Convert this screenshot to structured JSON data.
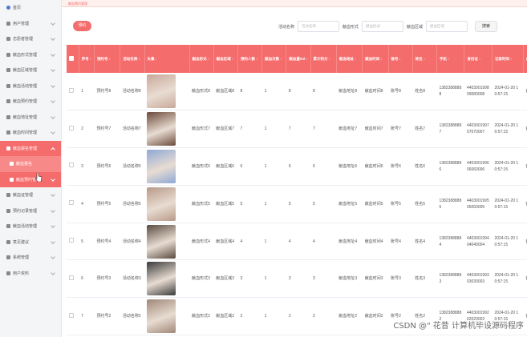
{
  "sidebar": {
    "items": [
      {
        "label": "首页",
        "icon": "home-icon"
      },
      {
        "label": "用户管理",
        "icon": "grid-icon"
      },
      {
        "label": "志愿者管理",
        "icon": "grid-icon"
      },
      {
        "label": "献血形式管理",
        "icon": "grid-icon"
      },
      {
        "label": "献血区域管理",
        "icon": "grid-icon"
      },
      {
        "label": "献血活动管理",
        "icon": "pin-icon"
      },
      {
        "label": "献血预约管理",
        "icon": "flag-icon"
      },
      {
        "label": "献血地址管理",
        "icon": "grid-icon"
      },
      {
        "label": "献血时间管理",
        "icon": "grid-icon"
      },
      {
        "label": "献血报名管理",
        "icon": "grid-icon"
      },
      {
        "label": "献血报名",
        "icon": "dot-icon"
      },
      {
        "label": "献血预约管理",
        "icon": "dot-icon"
      },
      {
        "label": "献血证管理",
        "icon": "card-icon"
      },
      {
        "label": "预约记录管理",
        "icon": "grid-icon"
      },
      {
        "label": "献血活动管理",
        "icon": "grid-icon"
      },
      {
        "label": "意见建议",
        "icon": "grid-icon"
      },
      {
        "label": "系统管理",
        "icon": "gear-icon"
      },
      {
        "label": "用户资料",
        "icon": "grid-icon"
      }
    ]
  },
  "topbar": {
    "text": "献血预约管理"
  },
  "toolbar": {
    "add_label": "预约",
    "filters": [
      {
        "label": "活动名称",
        "placeholder": "活动名称"
      },
      {
        "label": "献血形式",
        "placeholder": "献血形式"
      },
      {
        "label": "献血区域",
        "placeholder": "献血区域"
      }
    ],
    "search_label": "搜索"
  },
  "table": {
    "headers": [
      "序号",
      "预约号",
      "活动名称",
      "头像",
      "献血形式",
      "献血区域",
      "预约人数",
      "献血次数",
      "献血量/ml",
      "累计积分",
      "献血地址",
      "献血时间",
      "账号",
      "姓名",
      "手机",
      "身份证",
      "记录时间",
      "备注"
    ],
    "rows": [
      {
        "idx": "1",
        "no": "预约号8",
        "name": "活动名称8",
        "avatar": "#c9a89a",
        "form": "献血形式8",
        "area": "献血区域8",
        "people": "8",
        "times": "1",
        "vol": "8",
        "score": "8",
        "addr": "献血地址8",
        "time": "献血时间8",
        "acct": "账号8",
        "real": "姓名8",
        "phone": "13823888888",
        "idcard": "440300199809080008",
        "rec": "2024-01-20 10:57:15",
        "note": "备注8"
      },
      {
        "idx": "2",
        "no": "预约号7",
        "name": "活动名称7",
        "avatar": "#6b4a3a",
        "form": "献血形式7",
        "area": "献血区域7",
        "people": "7",
        "times": "1",
        "vol": "7",
        "score": "7",
        "addr": "献血地址7",
        "time": "献血时间7",
        "acct": "账号7",
        "real": "姓名7",
        "phone": "13823888887",
        "idcard": "440300199707070007",
        "rec": "2024-01-20 10:57:15",
        "note": "备注7"
      },
      {
        "idx": "3",
        "no": "预约号6",
        "name": "活动名称6",
        "avatar": "#8fa8d6",
        "form": "献血形式6",
        "area": "献血区域6",
        "people": "6",
        "times": "1",
        "vol": "6",
        "score": "6",
        "addr": "献血地址6",
        "time": "献血时间6",
        "acct": "账号6",
        "real": "姓名6",
        "phone": "13823888886",
        "idcard": "440300199606060006",
        "rec": "2024-01-20 10:57:15",
        "note": "备注6"
      },
      {
        "idx": "4",
        "no": "预约号5",
        "name": "活动名称5",
        "avatar": "#b89a88",
        "form": "献血形式5",
        "area": "献血区域5",
        "people": "5",
        "times": "1",
        "vol": "5",
        "score": "5",
        "addr": "献血地址5",
        "time": "献血时间5",
        "acct": "账号5",
        "real": "姓名5",
        "phone": "13823888885",
        "idcard": "440300199505050005",
        "rec": "2024-01-20 10:57:15",
        "note": "备注5"
      },
      {
        "idx": "5",
        "no": "预约号4",
        "name": "活动名称4",
        "avatar": "#5a4a3e",
        "form": "献血形式4",
        "area": "献血区域4",
        "people": "4",
        "times": "1",
        "vol": "4",
        "score": "4",
        "addr": "献血地址4",
        "time": "献血时间4",
        "acct": "账号4",
        "real": "姓名4",
        "phone": "13823888884",
        "idcard": "440300199404040004",
        "rec": "2024-01-20 10:57:15",
        "note": "备注4"
      },
      {
        "idx": "6",
        "no": "预约号3",
        "name": "活动名称3",
        "avatar": "#3a3a3a",
        "form": "献血形式3",
        "area": "献血区域3",
        "people": "3",
        "times": "1",
        "vol": "3",
        "score": "3",
        "addr": "献血地址3",
        "time": "献血时间3",
        "acct": "账号3",
        "real": "姓名3",
        "phone": "13823888883",
        "idcard": "440300199303030003",
        "rec": "2024-01-20 10:57:15",
        "note": "备注3"
      },
      {
        "idx": "7",
        "no": "预约号2",
        "name": "活动名称2",
        "avatar": "#a08878",
        "form": "献血形式2",
        "area": "献血区域2",
        "people": "2",
        "times": "1",
        "vol": "2",
        "score": "2",
        "addr": "献血地址2",
        "time": "献血时间2",
        "acct": "账号2",
        "real": "姓名2",
        "phone": "13823888882",
        "idcard": "440300199202020002",
        "rec": "2024-01-20 10:57:15",
        "note": "备注2"
      }
    ]
  },
  "watermark": "CSDN @\" 花昔  计算机毕设源码程序"
}
